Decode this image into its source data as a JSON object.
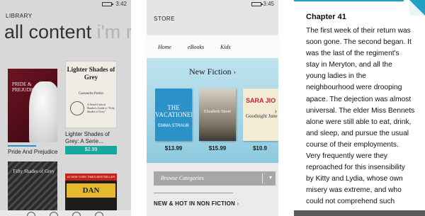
{
  "phone_library": {
    "battery_icon": "battery-icon",
    "time": "3:42",
    "header": "LIBRARY",
    "pivot_active": "all content",
    "pivot_next": "i'm r",
    "book_pp": {
      "cover_title": "PRIDE & PREJUDICE",
      "caption": "Pride And Prejudice",
      "progress": 0.55
    },
    "book_lsg": {
      "cover_title": "Lighter Shades of Grey",
      "cover_author": "Cassandra Parkin",
      "cover_desc": "A Seriel Critical Reader's Guide to \"Fifty Shades of Grey\"",
      "caption": "Lighter Shades of Grey: A Serie...",
      "price": "$2.99"
    },
    "book_fsg": {
      "cover_title": "Fifty Shades of Grey"
    },
    "book_db": {
      "banner": "#1 NEW YORK TIMES BESTSELLER",
      "author": "DAN BROWN"
    }
  },
  "phone_store": {
    "battery_icon": "battery-charging-icon",
    "time": "3:45",
    "header": "STORE",
    "tabs": [
      "Home",
      "eBooks",
      "Kids"
    ],
    "hero_title": "New Fiction",
    "hero_chevron": "›",
    "books": [
      {
        "title": "THE VACATIONERS",
        "author": "EMMA STRAUB",
        "price": "$13.99"
      },
      {
        "title": "Elizabeth Street",
        "price": "$15.99"
      },
      {
        "title": "SARA JIO",
        "subtitle": "Goodnight June",
        "price": "$10.9"
      }
    ],
    "browse_label": "Browse Categories",
    "browse_dropdown": "▾",
    "section_label": "NEW & HOT IN NON FICTION",
    "section_chevron": "›"
  },
  "phone_reader": {
    "chapter": "Chapter 41",
    "lines": [
      "The first week of their return was",
      "soon gone. The second began. It",
      "was the last of the regiment's",
      "stay in Meryton, and all the",
      "young ladies in the",
      "neighbourhood were drooping",
      "apace. The dejection was almost",
      "universal. The elder Miss Bennets",
      "alone were still able to eat, drink,",
      "and sleep, and pursue the usual",
      "course of their employments.",
      "Very frequently were they",
      "reproached for this insensibility",
      "by Kitty and Lydia, whose own",
      "misery was extreme, and who",
      "could not comprehend such"
    ]
  }
}
